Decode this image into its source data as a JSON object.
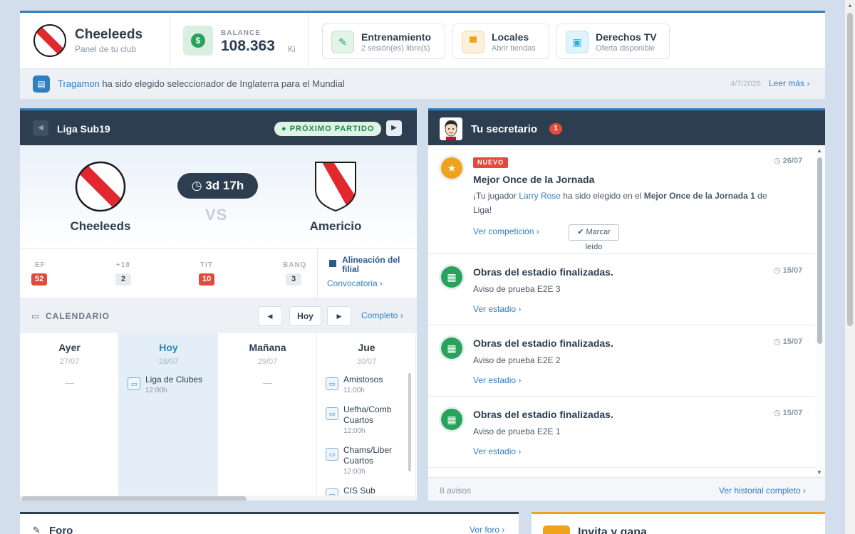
{
  "header": {
    "club_name": "Cheeleeds",
    "club_sub": "Panel de tu club",
    "balance_label": "BALANCE",
    "balance_value": "108.363",
    "balance_unit": "Ki",
    "quick": [
      {
        "title": "Entrenamiento",
        "sub": "2 sesión(es) libre(s)"
      },
      {
        "title": "Locales",
        "sub": "Abrir tiendas"
      },
      {
        "title": "Derechos TV",
        "sub": "Oferta disponible"
      }
    ]
  },
  "news": {
    "link_name": "Tragamon",
    "text": "ha sido elegido seleccionador de Inglaterra para el Mundial",
    "date": "4/7/2026",
    "more": "Leer más ›"
  },
  "match": {
    "league": "Liga Sub19",
    "status": "PRÓXIMO PARTIDO",
    "home": "Cheeleeds",
    "away": "Americio",
    "countdown": "3d 17h",
    "vs": "VS",
    "stats": [
      {
        "label": "EF",
        "value": "52"
      },
      {
        "label": "+18",
        "value": "2"
      },
      {
        "label": "TIT",
        "value": "10"
      },
      {
        "label": "BANQ",
        "value": "3"
      }
    ],
    "lineup_title": "Alineación del filial",
    "lineup_link": "Convocatoria ›"
  },
  "calendar": {
    "title": "CALENDARIO",
    "today_btn": "Hoy",
    "full_link": "Completo ›",
    "empty": "—",
    "days": [
      {
        "name": "Ayer",
        "date": "27/07"
      },
      {
        "name": "Hoy",
        "date": "28/07"
      },
      {
        "name": "Mañana",
        "date": "29/07"
      },
      {
        "name": "Jue",
        "date": "30/07"
      }
    ],
    "today_event": {
      "name": "Liga de Clubes",
      "time": "12:00h"
    },
    "thu_events": [
      {
        "name": "Amistosos",
        "time": "11:00h"
      },
      {
        "name": "Uefha/Comb Cuartos",
        "time": "12:00h"
      },
      {
        "name": "Chams/Liber Cuartos",
        "time": "12:00h"
      },
      {
        "name": "CIS Sub",
        "time": ""
      }
    ]
  },
  "secretary": {
    "title": "Tu secretario",
    "badge": "1",
    "items": [
      {
        "badge": "NUEVO",
        "title": "Mejor Once de la Jornada",
        "text_pre": "¡Tu jugador",
        "player": "Larry Rose",
        "text_mid": "ha sido elegido en el",
        "text_bold": "Mejor Once de la Jornada 1",
        "text_post": "de Liga!",
        "date": "26/07",
        "link": "Ver competición ›",
        "mark": "Marcar leído"
      },
      {
        "title": "Obras del estadio finalizadas.",
        "text": "Aviso de prueba E2E 3",
        "date": "15/07",
        "link": "Ver estadio ›"
      },
      {
        "title": "Obras del estadio finalizadas.",
        "text": "Aviso de prueba E2E 2",
        "date": "15/07",
        "link": "Ver estadio ›"
      },
      {
        "title": "Obras del estadio finalizadas.",
        "text": "Aviso de prueba E2E 1",
        "date": "15/07",
        "link": "Ver estadio ›"
      }
    ],
    "count": "8 avisos",
    "history": "Ver historial completo ›"
  },
  "forum": {
    "title": "Foro",
    "link": "Ver foro ›"
  },
  "invite": {
    "title": "Invita y gana"
  },
  "colors": {
    "accent": "#2f80c2",
    "navy": "#2d3e50",
    "red": "#e04b3a",
    "green": "#27a35b",
    "orange": "#f0a31a"
  }
}
